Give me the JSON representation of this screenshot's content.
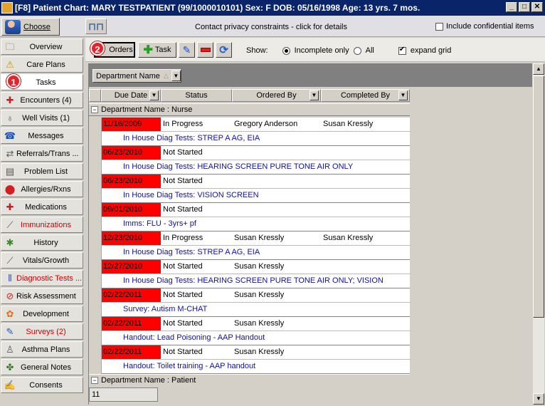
{
  "title": "[F8] Patient Chart: MARY TESTPATIENT (99/1000010101)  Sex: F  DOB: 05/16/1998  Age: 13 yrs. 7 mos.",
  "top": {
    "choose_label": "Choose",
    "privacy": "Contact privacy constraints - click for details",
    "include_confidential": "Include confidential items"
  },
  "sidebar": [
    {
      "label": "Overview",
      "icon": "folder-icon"
    },
    {
      "label": "Care Plans",
      "icon": "warning-icon"
    },
    {
      "label": "Tasks",
      "icon": "tasks-icon"
    },
    {
      "label": "Encounters (4)",
      "icon": "encounter-icon"
    },
    {
      "label": "Well Visits (1)",
      "icon": "stethoscope-icon"
    },
    {
      "label": "Messages",
      "icon": "phone-icon"
    },
    {
      "label": "Referrals/Trans ...",
      "icon": "referral-icon"
    },
    {
      "label": "Problem List",
      "icon": "problem-list-icon"
    },
    {
      "label": "Allergies/Rxns",
      "icon": "allergy-icon"
    },
    {
      "label": "Medications",
      "icon": "medication-icon"
    },
    {
      "label": "Immunizations",
      "icon": "syringe-icon"
    },
    {
      "label": "History",
      "icon": "tree-icon"
    },
    {
      "label": "Vitals/Growth",
      "icon": "vitals-icon"
    },
    {
      "label": "Diagnostic Tests ...",
      "icon": "test-tubes-icon"
    },
    {
      "label": "Risk Assessment",
      "icon": "no-sign-icon"
    },
    {
      "label": "Development",
      "icon": "development-icon"
    },
    {
      "label": "Surveys (2)",
      "icon": "survey-icon"
    },
    {
      "label": "Asthma Plans",
      "icon": "lungs-icon"
    },
    {
      "label": "General Notes",
      "icon": "notes-icon"
    },
    {
      "label": "Consents",
      "icon": "consent-icon"
    }
  ],
  "badges": {
    "b1": "1",
    "b2": "2"
  },
  "toolbar": {
    "orders": "Orders",
    "task": "Task",
    "show": "Show:",
    "incomplete_only": "Incomplete only",
    "all": "All",
    "expand_grid": "expand grid"
  },
  "group_chip": "Department Name",
  "columns": {
    "due": "Due Date",
    "status": "Status",
    "ordered_by": "Ordered By",
    "completed_by": "Completed By"
  },
  "group_nurse": "Department Name : Nurse",
  "group_patient": "Department Name : Patient",
  "rows": [
    {
      "due": "11/16/2009",
      "status": "In Progress",
      "ordered_by": "Gregory Anderson",
      "completed_by": "Susan Kressly",
      "desc": "In House Diag Tests: STREP A AG, EIA"
    },
    {
      "due": "06/23/2010",
      "status": "Not Started",
      "ordered_by": "",
      "completed_by": "",
      "desc": "In House Diag Tests: HEARING SCREEN PURE TONE AIR ONLY"
    },
    {
      "due": "06/23/2010",
      "status": "Not Started",
      "ordered_by": "",
      "completed_by": "",
      "desc": "In House Diag Tests: VISION SCREEN"
    },
    {
      "due": "09/01/2010",
      "status": "Not Started",
      "ordered_by": "",
      "completed_by": "",
      "desc": "Imms: FLU - 3yrs+ pf"
    },
    {
      "due": "12/23/2010",
      "status": "In Progress",
      "ordered_by": "Susan Kressly",
      "completed_by": "Susan Kressly",
      "desc": "In House Diag Tests: STREP A AG, EIA"
    },
    {
      "due": "12/27/2010",
      "status": "Not Started",
      "ordered_by": "Susan Kressly",
      "completed_by": "",
      "desc": "In House Diag Tests: HEARING SCREEN PURE TONE AIR ONLY; VISION SCREEN"
    },
    {
      "due": "02/22/2011",
      "status": "Not Started",
      "ordered_by": "Susan Kressly",
      "completed_by": "",
      "desc": "Survey: Autism M-CHAT"
    },
    {
      "due": "02/22/2011",
      "status": "Not Started",
      "ordered_by": "Susan Kressly",
      "completed_by": "",
      "desc": "Handout: Lead Poisoning - AAP Handout"
    },
    {
      "due": "02/22/2011",
      "status": "Not Started",
      "ordered_by": "Susan Kressly",
      "completed_by": "",
      "desc": "Handout: Toilet training - AAP handout"
    }
  ],
  "footer_count": "11",
  "colors": {
    "due_highlight": "#ff0000",
    "title_bg": "#0a246a",
    "desc_text": "#1010a0"
  }
}
